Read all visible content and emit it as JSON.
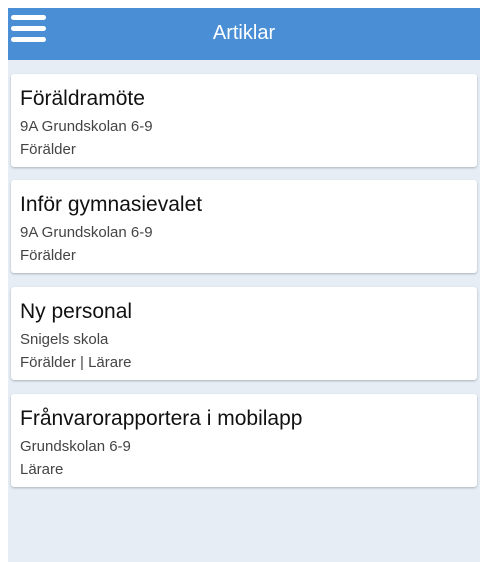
{
  "header": {
    "title": "Artiklar",
    "menu_icon": "hamburger-menu-icon",
    "background_color": "#4a8fd6"
  },
  "background_color": "#e6edf5",
  "articles": [
    {
      "title": "Föräldramöte",
      "school": "9A Grundskolan 6-9",
      "audience": "Förälder"
    },
    {
      "title": "Inför gymnasievalet",
      "school": "9A Grundskolan 6-9",
      "audience": "Förälder"
    },
    {
      "title": "Ny personal",
      "school": "Snigels skola",
      "audience": "Förälder | Lärare"
    },
    {
      "title": "Frånvarorapportera i mobilapp",
      "school": "Grundskolan 6-9",
      "audience": "Lärare"
    }
  ]
}
